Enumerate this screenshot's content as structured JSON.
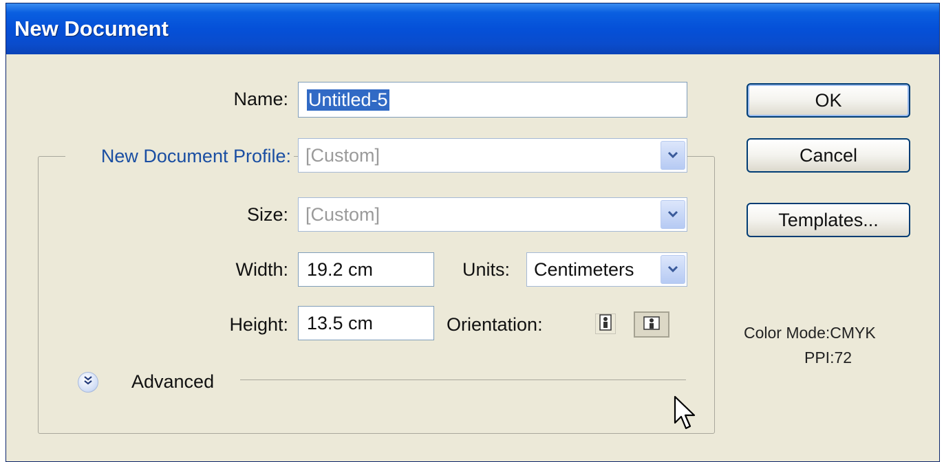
{
  "window": {
    "title": "New Document"
  },
  "form": {
    "name_label": "Name:",
    "name_value": "Untitled-5",
    "profile_label": "New Document Profile:",
    "profile_value": "[Custom]",
    "size_label": "Size:",
    "size_value": "[Custom]",
    "width_label": "Width:",
    "width_value": "19.2 cm",
    "units_label": "Units:",
    "units_value": "Centimeters",
    "height_label": "Height:",
    "height_value": "13.5 cm",
    "orientation_label": "Orientation:",
    "orientation_options": [
      "portrait-icon",
      "landscape-icon"
    ],
    "orientation_selected": "landscape",
    "advanced_label": "Advanced"
  },
  "buttons": {
    "ok": "OK",
    "cancel": "Cancel",
    "templates": "Templates..."
  },
  "info": {
    "color_mode": "Color Mode:CMYK",
    "ppi": "PPI:72"
  },
  "colors": {
    "title_bar": "#0550d8",
    "dialog_bg": "#ECE9D8",
    "selection": "#316ac5",
    "group_label": "#1a4ea2"
  }
}
